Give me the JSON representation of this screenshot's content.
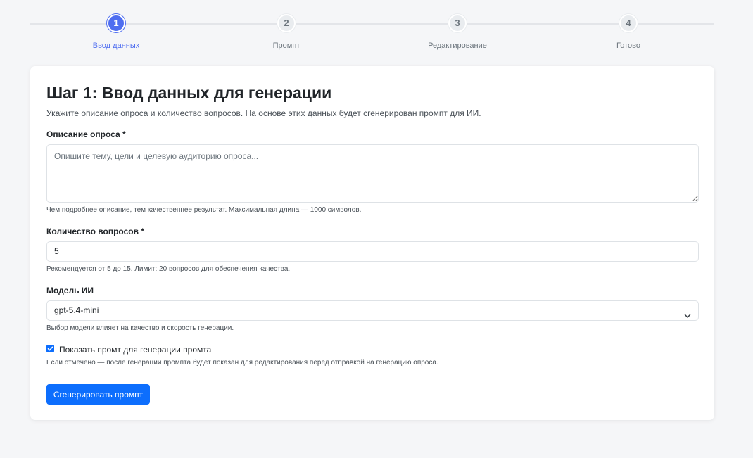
{
  "stepper": {
    "steps": [
      {
        "number": "1",
        "label": "Ввод данных",
        "active": true
      },
      {
        "number": "2",
        "label": "Промпт",
        "active": false
      },
      {
        "number": "3",
        "label": "Редактирование",
        "active": false
      },
      {
        "number": "4",
        "label": "Готово",
        "active": false
      }
    ]
  },
  "card": {
    "title": "Шаг 1: Ввод данных для генерации",
    "subtitle": "Укажите описание опроса и количество вопросов. На основе этих данных будет сгенерирован промпт для ИИ."
  },
  "form": {
    "description": {
      "label": "Описание опроса *",
      "placeholder": "Опишите тему, цели и целевую аудиторию опроса...",
      "value": "",
      "hint": "Чем подробнее описание, тем качественнее результат. Максимальная длина — 1000 символов."
    },
    "question_count": {
      "label": "Количество вопросов *",
      "value": "5",
      "hint": "Рекомендуется от 5 до 15. Лимит: 20 вопросов для обеспечения качества."
    },
    "model": {
      "label": "Модель ИИ",
      "selected": "gpt-5.4-mini",
      "hint": "Выбор модели влияет на качество и скорость генерации."
    },
    "show_prompt": {
      "checked": true,
      "label": "Показать промт для генерации промта",
      "hint": "Если отмечено — после генерации промпта будет показан для редактирования перед отправкой на генерацию опроса."
    },
    "submit_label": "Сгенерировать промпт"
  },
  "colors": {
    "accent": "#4f6ef0",
    "primary_button": "#0d6efd",
    "background": "#f5f6f8"
  }
}
